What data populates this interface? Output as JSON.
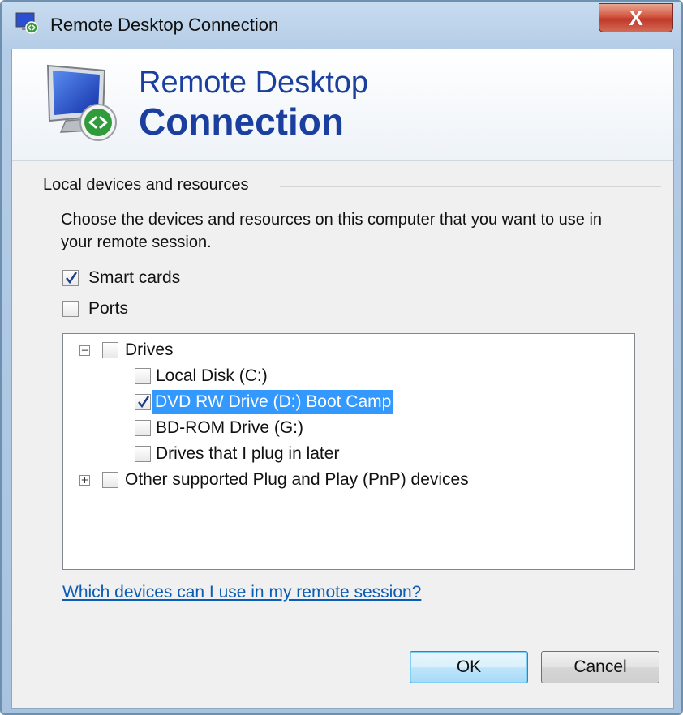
{
  "window": {
    "title": "Remote Desktop Connection",
    "close_glyph": "X"
  },
  "banner": {
    "line1": "Remote Desktop",
    "line2": "Connection"
  },
  "section": {
    "label": "Local devices and resources",
    "description": "Choose the devices and resources on this computer that you want to use in your remote session."
  },
  "options": {
    "smart_cards": {
      "label": "Smart cards",
      "checked": true
    },
    "ports": {
      "label": "Ports",
      "checked": false
    }
  },
  "tree": {
    "drives": {
      "label": "Drives",
      "expander": "−",
      "checked": false
    },
    "drive_items": [
      {
        "label": "Local Disk  (C:)",
        "checked": false
      },
      {
        "label": "DVD RW Drive (D:) Boot Camp",
        "checked": true,
        "selected": true
      },
      {
        "label": "BD-ROM Drive (G:)",
        "checked": false
      },
      {
        "label": "Drives that I plug in later",
        "checked": false
      }
    ],
    "pnp": {
      "label": "Other supported Plug and Play (PnP) devices",
      "expander": "+",
      "checked": false
    }
  },
  "help_link": "Which devices can I use in my remote session?",
  "buttons": {
    "ok": "OK",
    "cancel": "Cancel"
  },
  "colors": {
    "title_blue": "#1b3f9e",
    "selection": "#3399ff",
    "link": "#0a5cb4"
  },
  "icons": [
    "remote-desktop-icon",
    "checkbox-check-icon",
    "tree-collapse-icon",
    "tree-expand-icon",
    "close-icon"
  ]
}
